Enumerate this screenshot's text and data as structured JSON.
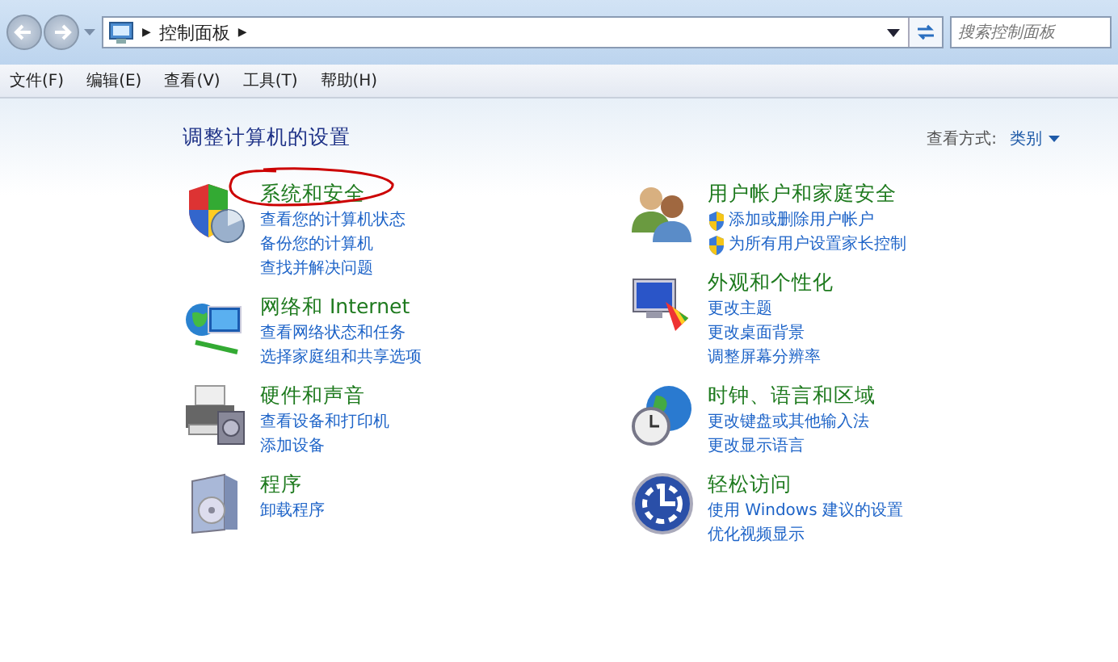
{
  "address_bar": {
    "path": "控制面板",
    "separator": "▶"
  },
  "search": {
    "placeholder": "搜索控制面板"
  },
  "menu": [
    "文件(F)",
    "编辑(E)",
    "查看(V)",
    "工具(T)",
    "帮助(H)"
  ],
  "heading": "调整计算机的设置",
  "view_by": {
    "label": "查看方式:",
    "value": "类别"
  },
  "columns": [
    [
      {
        "title": "系统和安全",
        "annotated": true,
        "links": [
          {
            "text": "查看您的计算机状态",
            "shield": false
          },
          {
            "text": "备份您的计算机",
            "shield": false
          },
          {
            "text": "查找并解决问题",
            "shield": false
          }
        ]
      },
      {
        "title": "网络和 Internet",
        "annotated": false,
        "links": [
          {
            "text": "查看网络状态和任务",
            "shield": false
          },
          {
            "text": "选择家庭组和共享选项",
            "shield": false
          }
        ]
      },
      {
        "title": "硬件和声音",
        "annotated": false,
        "links": [
          {
            "text": "查看设备和打印机",
            "shield": false
          },
          {
            "text": "添加设备",
            "shield": false
          }
        ]
      },
      {
        "title": "程序",
        "annotated": false,
        "links": [
          {
            "text": "卸载程序",
            "shield": false
          }
        ]
      }
    ],
    [
      {
        "title": "用户帐户和家庭安全",
        "annotated": false,
        "links": [
          {
            "text": "添加或删除用户帐户",
            "shield": true
          },
          {
            "text": "为所有用户设置家长控制",
            "shield": true
          }
        ]
      },
      {
        "title": "外观和个性化",
        "annotated": false,
        "links": [
          {
            "text": "更改主题",
            "shield": false
          },
          {
            "text": "更改桌面背景",
            "shield": false
          },
          {
            "text": "调整屏幕分辨率",
            "shield": false
          }
        ]
      },
      {
        "title": "时钟、语言和区域",
        "annotated": false,
        "links": [
          {
            "text": "更改键盘或其他输入法",
            "shield": false
          },
          {
            "text": "更改显示语言",
            "shield": false
          }
        ]
      },
      {
        "title": "轻松访问",
        "annotated": false,
        "links": [
          {
            "text": "使用 Windows 建议的设置",
            "shield": false
          },
          {
            "text": "优化视频显示",
            "shield": false
          }
        ]
      }
    ]
  ]
}
